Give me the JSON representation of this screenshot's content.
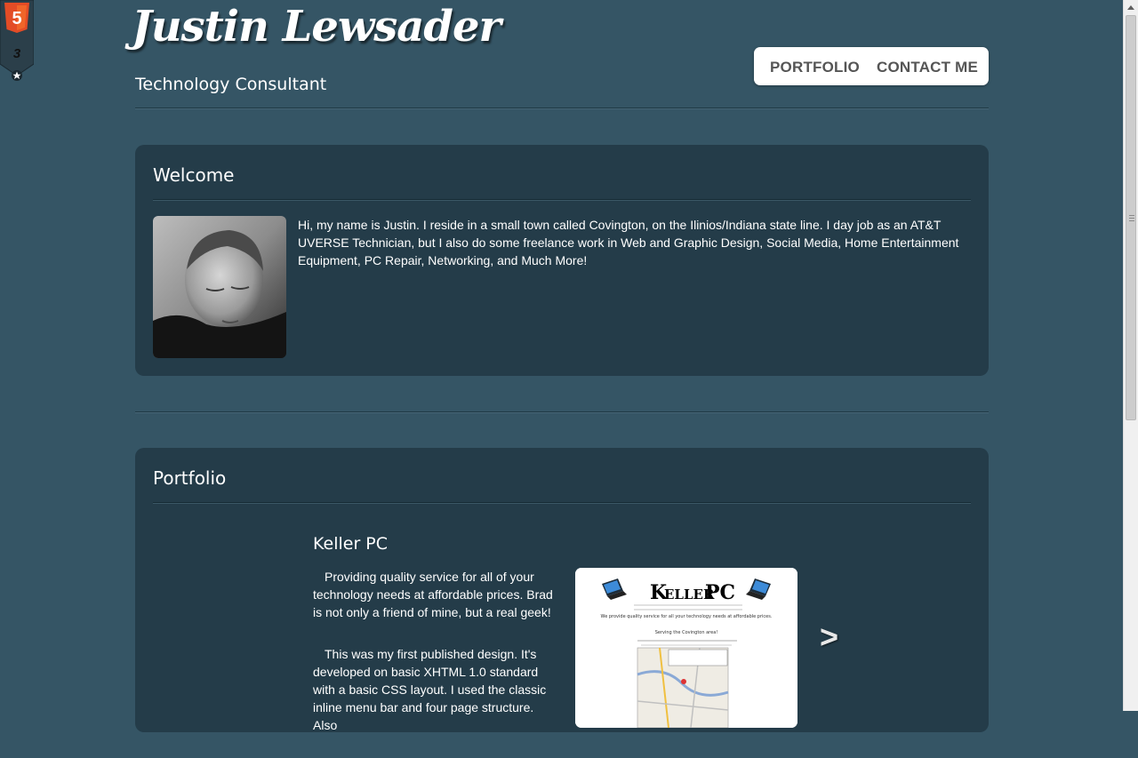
{
  "header": {
    "logo_text": "Justin Lewsader",
    "tagline": "Technology Consultant"
  },
  "nav": {
    "items": [
      {
        "label": "PORTFOLIO"
      },
      {
        "label": "CONTACT ME"
      }
    ]
  },
  "badge": {
    "icons": [
      "html5-icon",
      "css3-icon",
      "star-icon"
    ],
    "html5_label": "5",
    "css3_label": "3",
    "colors": {
      "html5": "#e34c26",
      "ribbon": "#2b3f4a"
    }
  },
  "welcome": {
    "title": "Welcome",
    "bio": "Hi, my name is Justin. I reside in a small town called Covington, on the Ilinios/Indiana state line. I day job as an AT&T UVERSE Technician, but I also do some freelance work in Web and Graphic Design, Social Media, Home Entertainment Equipment, PC Repair, Networking, and Much More!"
  },
  "portfolio": {
    "title": "Portfolio",
    "project": {
      "name": "Keller PC",
      "paragraphs": [
        "Providing quality service for all of your technology needs at affordable prices. Brad is not only a friend of mine, but a real geek!",
        "This was my first published design. It's developed on basic XHTML 1.0 standard with a basic CSS layout. I used the classic inline menu bar and four page structure. Also"
      ],
      "screenshot": {
        "brand_k": "K",
        "brand_rest": "ELLER",
        "brand_pc": "PC",
        "tagline": "We provide quality service for all your technology needs at affordable prices.",
        "subline": "Serving the Covington area!"
      },
      "next_label": ">"
    }
  },
  "colors": {
    "page_bg": "#355565",
    "panel_bg": "#243c49",
    "nav_text": "#555555"
  }
}
